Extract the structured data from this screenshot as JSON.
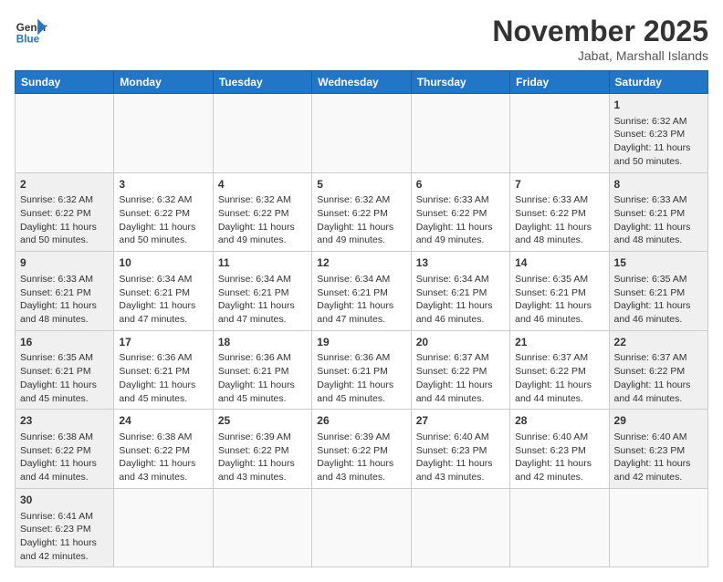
{
  "header": {
    "logo_general": "General",
    "logo_blue": "Blue",
    "month_title": "November 2025",
    "subtitle": "Jabat, Marshall Islands"
  },
  "days_of_week": [
    "Sunday",
    "Monday",
    "Tuesday",
    "Wednesday",
    "Thursday",
    "Friday",
    "Saturday"
  ],
  "weeks": [
    [
      {
        "day": "",
        "info": ""
      },
      {
        "day": "",
        "info": ""
      },
      {
        "day": "",
        "info": ""
      },
      {
        "day": "",
        "info": ""
      },
      {
        "day": "",
        "info": ""
      },
      {
        "day": "",
        "info": ""
      },
      {
        "day": "1",
        "info": "Sunrise: 6:32 AM\nSunset: 6:23 PM\nDaylight: 11 hours and 50 minutes."
      }
    ],
    [
      {
        "day": "2",
        "info": "Sunrise: 6:32 AM\nSunset: 6:22 PM\nDaylight: 11 hours and 50 minutes."
      },
      {
        "day": "3",
        "info": "Sunrise: 6:32 AM\nSunset: 6:22 PM\nDaylight: 11 hours and 50 minutes."
      },
      {
        "day": "4",
        "info": "Sunrise: 6:32 AM\nSunset: 6:22 PM\nDaylight: 11 hours and 49 minutes."
      },
      {
        "day": "5",
        "info": "Sunrise: 6:32 AM\nSunset: 6:22 PM\nDaylight: 11 hours and 49 minutes."
      },
      {
        "day": "6",
        "info": "Sunrise: 6:33 AM\nSunset: 6:22 PM\nDaylight: 11 hours and 49 minutes."
      },
      {
        "day": "7",
        "info": "Sunrise: 6:33 AM\nSunset: 6:22 PM\nDaylight: 11 hours and 48 minutes."
      },
      {
        "day": "8",
        "info": "Sunrise: 6:33 AM\nSunset: 6:21 PM\nDaylight: 11 hours and 48 minutes."
      }
    ],
    [
      {
        "day": "9",
        "info": "Sunrise: 6:33 AM\nSunset: 6:21 PM\nDaylight: 11 hours and 48 minutes."
      },
      {
        "day": "10",
        "info": "Sunrise: 6:34 AM\nSunset: 6:21 PM\nDaylight: 11 hours and 47 minutes."
      },
      {
        "day": "11",
        "info": "Sunrise: 6:34 AM\nSunset: 6:21 PM\nDaylight: 11 hours and 47 minutes."
      },
      {
        "day": "12",
        "info": "Sunrise: 6:34 AM\nSunset: 6:21 PM\nDaylight: 11 hours and 47 minutes."
      },
      {
        "day": "13",
        "info": "Sunrise: 6:34 AM\nSunset: 6:21 PM\nDaylight: 11 hours and 46 minutes."
      },
      {
        "day": "14",
        "info": "Sunrise: 6:35 AM\nSunset: 6:21 PM\nDaylight: 11 hours and 46 minutes."
      },
      {
        "day": "15",
        "info": "Sunrise: 6:35 AM\nSunset: 6:21 PM\nDaylight: 11 hours and 46 minutes."
      }
    ],
    [
      {
        "day": "16",
        "info": "Sunrise: 6:35 AM\nSunset: 6:21 PM\nDaylight: 11 hours and 45 minutes."
      },
      {
        "day": "17",
        "info": "Sunrise: 6:36 AM\nSunset: 6:21 PM\nDaylight: 11 hours and 45 minutes."
      },
      {
        "day": "18",
        "info": "Sunrise: 6:36 AM\nSunset: 6:21 PM\nDaylight: 11 hours and 45 minutes."
      },
      {
        "day": "19",
        "info": "Sunrise: 6:36 AM\nSunset: 6:21 PM\nDaylight: 11 hours and 45 minutes."
      },
      {
        "day": "20",
        "info": "Sunrise: 6:37 AM\nSunset: 6:22 PM\nDaylight: 11 hours and 44 minutes."
      },
      {
        "day": "21",
        "info": "Sunrise: 6:37 AM\nSunset: 6:22 PM\nDaylight: 11 hours and 44 minutes."
      },
      {
        "day": "22",
        "info": "Sunrise: 6:37 AM\nSunset: 6:22 PM\nDaylight: 11 hours and 44 minutes."
      }
    ],
    [
      {
        "day": "23",
        "info": "Sunrise: 6:38 AM\nSunset: 6:22 PM\nDaylight: 11 hours and 44 minutes."
      },
      {
        "day": "24",
        "info": "Sunrise: 6:38 AM\nSunset: 6:22 PM\nDaylight: 11 hours and 43 minutes."
      },
      {
        "day": "25",
        "info": "Sunrise: 6:39 AM\nSunset: 6:22 PM\nDaylight: 11 hours and 43 minutes."
      },
      {
        "day": "26",
        "info": "Sunrise: 6:39 AM\nSunset: 6:22 PM\nDaylight: 11 hours and 43 minutes."
      },
      {
        "day": "27",
        "info": "Sunrise: 6:40 AM\nSunset: 6:23 PM\nDaylight: 11 hours and 43 minutes."
      },
      {
        "day": "28",
        "info": "Sunrise: 6:40 AM\nSunset: 6:23 PM\nDaylight: 11 hours and 42 minutes."
      },
      {
        "day": "29",
        "info": "Sunrise: 6:40 AM\nSunset: 6:23 PM\nDaylight: 11 hours and 42 minutes."
      }
    ],
    [
      {
        "day": "30",
        "info": "Sunrise: 6:41 AM\nSunset: 6:23 PM\nDaylight: 11 hours and 42 minutes."
      },
      {
        "day": "",
        "info": ""
      },
      {
        "day": "",
        "info": ""
      },
      {
        "day": "",
        "info": ""
      },
      {
        "day": "",
        "info": ""
      },
      {
        "day": "",
        "info": ""
      },
      {
        "day": "",
        "info": ""
      }
    ]
  ]
}
